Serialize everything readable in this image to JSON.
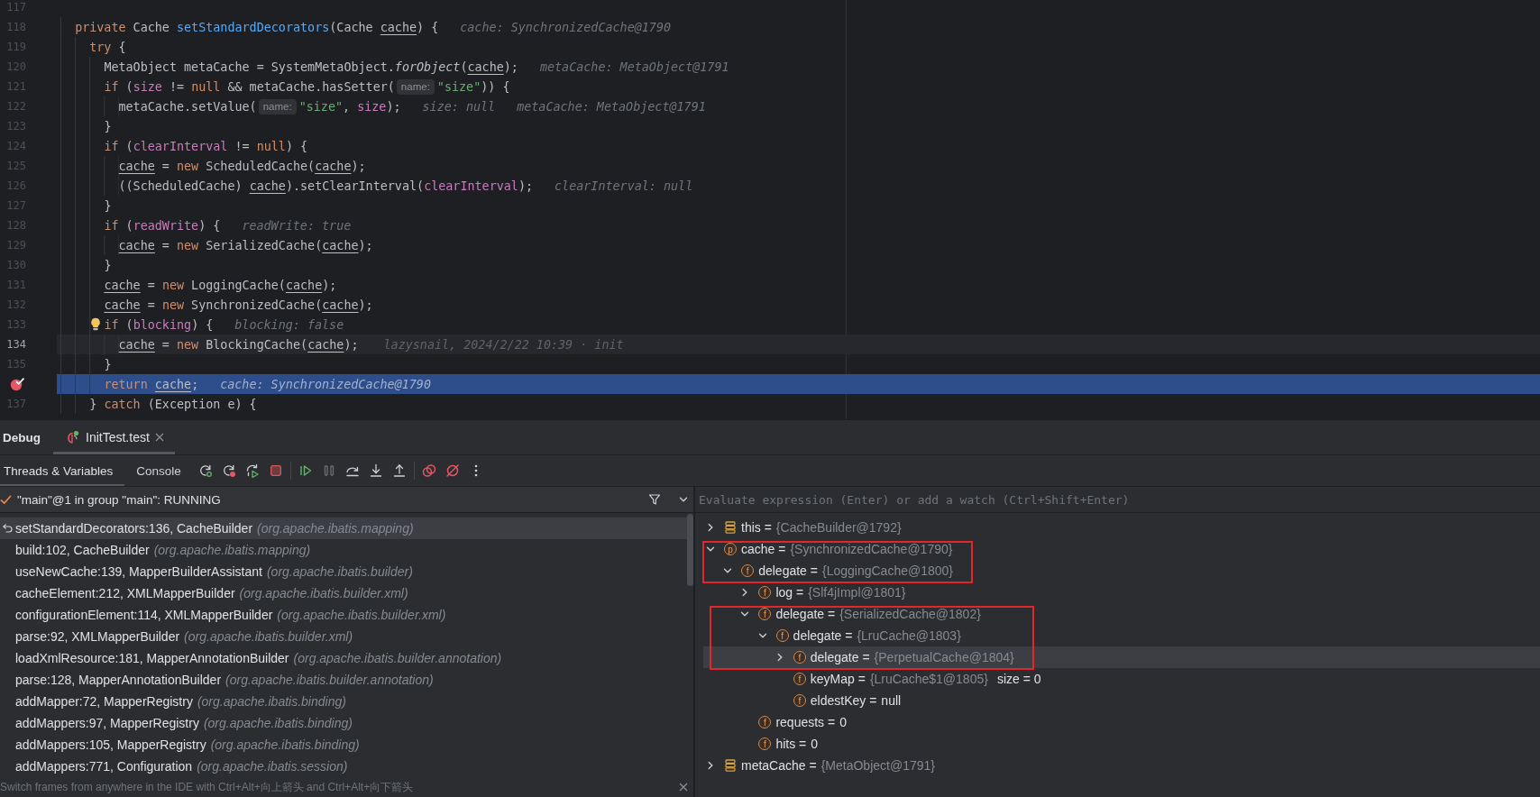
{
  "editor": {
    "lines": [
      {
        "number": "117",
        "current": false,
        "executing": false,
        "breakpoint": false,
        "bulb": false
      },
      {
        "number": "118",
        "current": false,
        "executing": false,
        "breakpoint": false,
        "bulb": false,
        "tokens": [
          {
            "kind": "keyword",
            "text": "  private"
          },
          {
            "kind": "plain",
            "text": " Cache "
          },
          {
            "kind": "method",
            "text": "setStandardDecorators"
          },
          {
            "kind": "plain",
            "text": "(Cache "
          },
          {
            "kind": "param",
            "text": "cache"
          },
          {
            "kind": "plain",
            "text": ") {"
          },
          {
            "kind": "value",
            "text": "cache: SynchronizedCache@1790"
          }
        ]
      },
      {
        "number": "119",
        "current": false,
        "executing": false,
        "breakpoint": false,
        "bulb": false,
        "tokens": [
          {
            "kind": "keyword",
            "text": "    try"
          },
          {
            "kind": "plain",
            "text": " {"
          }
        ]
      },
      {
        "number": "120",
        "current": false,
        "executing": false,
        "breakpoint": false,
        "bulb": false,
        "tokens": [
          {
            "kind": "plain",
            "text": "      MetaObject metaCache = SystemMetaObject."
          },
          {
            "kind": "static",
            "text": "forObject"
          },
          {
            "kind": "plain",
            "text": "("
          },
          {
            "kind": "param",
            "text": "cache"
          },
          {
            "kind": "plain",
            "text": ");"
          },
          {
            "kind": "value",
            "text": "metaCache: MetaObject@1791"
          }
        ]
      },
      {
        "number": "121",
        "current": false,
        "executing": false,
        "breakpoint": false,
        "bulb": false,
        "tokens": [
          {
            "kind": "keyword",
            "text": "      if"
          },
          {
            "kind": "plain",
            "text": " ("
          },
          {
            "kind": "field",
            "text": "size"
          },
          {
            "kind": "plain",
            "text": " != "
          },
          {
            "kind": "keyword",
            "text": "null"
          },
          {
            "kind": "plain",
            "text": " && metaCache.hasSetter("
          },
          {
            "kind": "hint",
            "text": "name:"
          },
          {
            "kind": "string",
            "text": "\"size\""
          },
          {
            "kind": "plain",
            "text": ")) {"
          }
        ]
      },
      {
        "number": "122",
        "current": false,
        "executing": false,
        "breakpoint": false,
        "bulb": false,
        "tokens": [
          {
            "kind": "plain",
            "text": "        metaCache.setValue("
          },
          {
            "kind": "hint",
            "text": "name:"
          },
          {
            "kind": "string",
            "text": "\"size\""
          },
          {
            "kind": "plain",
            "text": ", "
          },
          {
            "kind": "field",
            "text": "size"
          },
          {
            "kind": "plain",
            "text": ");"
          },
          {
            "kind": "value",
            "text": "size: null"
          },
          {
            "kind": "value",
            "text": "metaCache: MetaObject@1791"
          }
        ]
      },
      {
        "number": "123",
        "current": false,
        "executing": false,
        "breakpoint": false,
        "bulb": false,
        "tokens": [
          {
            "kind": "plain",
            "text": "      }"
          }
        ]
      },
      {
        "number": "124",
        "current": false,
        "executing": false,
        "breakpoint": false,
        "bulb": false,
        "tokens": [
          {
            "kind": "keyword",
            "text": "      if"
          },
          {
            "kind": "plain",
            "text": " ("
          },
          {
            "kind": "field",
            "text": "clearInterval"
          },
          {
            "kind": "plain",
            "text": " != "
          },
          {
            "kind": "keyword",
            "text": "null"
          },
          {
            "kind": "plain",
            "text": ") {"
          }
        ]
      },
      {
        "number": "125",
        "current": false,
        "executing": false,
        "breakpoint": false,
        "bulb": false,
        "tokens": [
          {
            "kind": "param",
            "text": "        cache"
          },
          {
            "kind": "plain",
            "text": " = "
          },
          {
            "kind": "keyword",
            "text": "new"
          },
          {
            "kind": "plain",
            "text": " ScheduledCache("
          },
          {
            "kind": "param",
            "text": "cache"
          },
          {
            "kind": "plain",
            "text": ");"
          }
        ]
      },
      {
        "number": "126",
        "current": false,
        "executing": false,
        "breakpoint": false,
        "bulb": false,
        "tokens": [
          {
            "kind": "plain",
            "text": "        ((ScheduledCache) "
          },
          {
            "kind": "param",
            "text": "cache"
          },
          {
            "kind": "plain",
            "text": ").setClearInterval("
          },
          {
            "kind": "field",
            "text": "clearInterval"
          },
          {
            "kind": "plain",
            "text": ");"
          },
          {
            "kind": "value",
            "text": "clearInterval: null"
          }
        ]
      },
      {
        "number": "127",
        "current": false,
        "executing": false,
        "breakpoint": false,
        "bulb": false,
        "tokens": [
          {
            "kind": "plain",
            "text": "      }"
          }
        ]
      },
      {
        "number": "128",
        "current": false,
        "executing": false,
        "breakpoint": false,
        "bulb": false,
        "tokens": [
          {
            "kind": "keyword",
            "text": "      if"
          },
          {
            "kind": "plain",
            "text": " ("
          },
          {
            "kind": "field",
            "text": "readWrite"
          },
          {
            "kind": "plain",
            "text": ") {"
          },
          {
            "kind": "value",
            "text": "readWrite: true"
          }
        ]
      },
      {
        "number": "129",
        "current": false,
        "executing": false,
        "breakpoint": false,
        "bulb": false,
        "tokens": [
          {
            "kind": "param",
            "text": "        cache"
          },
          {
            "kind": "plain",
            "text": " = "
          },
          {
            "kind": "keyword",
            "text": "new"
          },
          {
            "kind": "plain",
            "text": " SerializedCache("
          },
          {
            "kind": "param",
            "text": "cache"
          },
          {
            "kind": "plain",
            "text": ");"
          }
        ]
      },
      {
        "number": "130",
        "current": false,
        "executing": false,
        "breakpoint": false,
        "bulb": false,
        "tokens": [
          {
            "kind": "plain",
            "text": "      }"
          }
        ]
      },
      {
        "number": "131",
        "current": false,
        "executing": false,
        "breakpoint": false,
        "bulb": false,
        "tokens": [
          {
            "kind": "param",
            "text": "      cache"
          },
          {
            "kind": "plain",
            "text": " = "
          },
          {
            "kind": "keyword",
            "text": "new"
          },
          {
            "kind": "plain",
            "text": " LoggingCache("
          },
          {
            "kind": "param",
            "text": "cache"
          },
          {
            "kind": "plain",
            "text": ");"
          }
        ]
      },
      {
        "number": "132",
        "current": false,
        "executing": false,
        "breakpoint": false,
        "bulb": false,
        "tokens": [
          {
            "kind": "param",
            "text": "      cache"
          },
          {
            "kind": "plain",
            "text": " = "
          },
          {
            "kind": "keyword",
            "text": "new"
          },
          {
            "kind": "plain",
            "text": " SynchronizedCache("
          },
          {
            "kind": "param",
            "text": "cache"
          },
          {
            "kind": "plain",
            "text": ");"
          }
        ]
      },
      {
        "number": "133",
        "current": false,
        "executing": false,
        "breakpoint": false,
        "bulb": true,
        "tokens": [
          {
            "kind": "keyword",
            "text": "      if"
          },
          {
            "kind": "plain",
            "text": " ("
          },
          {
            "kind": "field",
            "text": "blocking"
          },
          {
            "kind": "plain",
            "text": ") {"
          },
          {
            "kind": "value",
            "text": "blocking: false"
          }
        ]
      },
      {
        "number": "134",
        "current": true,
        "executing": false,
        "breakpoint": false,
        "bulb": false,
        "tokens": [
          {
            "kind": "param",
            "text": "        cache"
          },
          {
            "kind": "plain",
            "text": " = "
          },
          {
            "kind": "keyword",
            "text": "new"
          },
          {
            "kind": "plain",
            "text": " BlockingCache("
          },
          {
            "kind": "param",
            "text": "cache"
          },
          {
            "kind": "plain",
            "text": ");"
          },
          {
            "kind": "blame",
            "text": "lazysnail, 2024/2/22 10:39 · init"
          }
        ]
      },
      {
        "number": "135",
        "current": false,
        "executing": false,
        "breakpoint": false,
        "bulb": false,
        "tokens": [
          {
            "kind": "plain",
            "text": "      }"
          }
        ]
      },
      {
        "current": false,
        "executing": true,
        "breakpoint": true,
        "bulb": false,
        "tokens": [
          {
            "kind": "keyword",
            "text": "      return "
          },
          {
            "kind": "param",
            "text": "cache"
          },
          {
            "kind": "plain",
            "text": ";"
          },
          {
            "kind": "value",
            "text": "cache: SynchronizedCache@1790"
          }
        ]
      },
      {
        "number": "137",
        "current": false,
        "executing": false,
        "breakpoint": false,
        "bulb": false,
        "tokens": [
          {
            "kind": "plain",
            "text": "    } "
          },
          {
            "kind": "keyword",
            "text": "catch"
          },
          {
            "kind": "plain",
            "text": " (Exception e) {"
          }
        ]
      }
    ]
  },
  "debug": {
    "title": "Debug",
    "sessions": [
      {
        "label": "InitTest.test",
        "selected": true
      }
    ],
    "view_tabs": [
      {
        "label": "Threads & Variables",
        "selected": true
      },
      {
        "label": "Console",
        "selected": false
      }
    ],
    "action_groups": [
      {
        "actions": [
          {
            "kind": "rerun",
            "disabled": false
          },
          {
            "kind": "rerun_failed",
            "disabled": false
          },
          {
            "kind": "reload",
            "disabled": false
          },
          {
            "kind": "stop",
            "disabled": false
          }
        ]
      },
      {
        "actions": [
          {
            "kind": "resume",
            "disabled": false
          },
          {
            "kind": "pause",
            "disabled": true
          },
          {
            "kind": "step_over",
            "disabled": false
          },
          {
            "kind": "step_into",
            "disabled": false
          },
          {
            "kind": "step_out",
            "disabled": false
          }
        ]
      },
      {
        "actions": [
          {
            "kind": "breakpoints",
            "disabled": false
          },
          {
            "kind": "mute_breakpoints",
            "disabled": false
          },
          {
            "kind": "more",
            "disabled": false
          }
        ]
      }
    ],
    "thread": {
      "label": "\"main\"@1 in group \"main\": RUNNING"
    },
    "frames": [
      {
        "kind": "current",
        "method": "setStandardDecorators:136, CacheBuilder",
        "package": "(org.apache.ibatis.mapping)",
        "selected": true
      },
      {
        "kind": "caller",
        "method": "build:102, CacheBuilder",
        "package": "(org.apache.ibatis.mapping)",
        "selected": false
      },
      {
        "kind": "caller",
        "method": "useNewCache:139, MapperBuilderAssistant",
        "package": "(org.apache.ibatis.builder)",
        "selected": false
      },
      {
        "kind": "caller",
        "method": "cacheElement:212, XMLMapperBuilder",
        "package": "(org.apache.ibatis.builder.xml)",
        "selected": false
      },
      {
        "kind": "caller",
        "method": "configurationElement:114, XMLMapperBuilder",
        "package": "(org.apache.ibatis.builder.xml)",
        "selected": false
      },
      {
        "kind": "caller",
        "method": "parse:92, XMLMapperBuilder",
        "package": "(org.apache.ibatis.builder.xml)",
        "selected": false
      },
      {
        "kind": "caller",
        "method": "loadXmlResource:181, MapperAnnotationBuilder",
        "package": "(org.apache.ibatis.builder.annotation)",
        "selected": false
      },
      {
        "kind": "caller",
        "method": "parse:128, MapperAnnotationBuilder",
        "package": "(org.apache.ibatis.builder.annotation)",
        "selected": false
      },
      {
        "kind": "caller",
        "method": "addMapper:72, MapperRegistry",
        "package": "(org.apache.ibatis.binding)",
        "selected": false
      },
      {
        "kind": "caller",
        "method": "addMappers:97, MapperRegistry",
        "package": "(org.apache.ibatis.binding)",
        "selected": false
      },
      {
        "kind": "caller",
        "method": "addMappers:105, MapperRegistry",
        "package": "(org.apache.ibatis.binding)",
        "selected": false
      },
      {
        "kind": "caller",
        "method": "addMappers:771, Configuration",
        "package": "(org.apache.ibatis.session)",
        "selected": false
      }
    ],
    "hint": "Switch frames from anywhere in the IDE with Ctrl+Alt+向上箭头 and Ctrl+Alt+向下箭头",
    "variables": {
      "placeholder": "Evaluate expression (Enter) or add a watch (Ctrl+Shift+Enter)",
      "items": [
        {
          "kind": "object",
          "label": "this =",
          "value": "{CacheBuilder@1792}",
          "value_dimmed": true,
          "expandable": true,
          "expanded": false,
          "selected": false,
          "outlined": false
        },
        {
          "kind": "parameter",
          "badge": "p",
          "label": "cache =",
          "value": "{SynchronizedCache@1790}",
          "value_dimmed": true,
          "expandable": true,
          "expanded": true,
          "selected": false,
          "outlined": true,
          "children": [
            {
              "kind": "field",
              "badge": "f",
              "label": "delegate =",
              "value": "{LoggingCache@1800}",
              "value_dimmed": true,
              "expandable": true,
              "expanded": true,
              "selected": false,
              "outlined": true,
              "children": [
                {
                  "kind": "field",
                  "badge": "f",
                  "label": "log =",
                  "value": "{Slf4jImpl@1801}",
                  "value_dimmed": true,
                  "expandable": true,
                  "expanded": false,
                  "selected": false,
                  "outlined": false
                },
                {
                  "kind": "field",
                  "badge": "f",
                  "label": "delegate =",
                  "value": "{SerializedCache@1802}",
                  "value_dimmed": true,
                  "expandable": true,
                  "expanded": true,
                  "selected": false,
                  "outlined": true,
                  "children": [
                    {
                      "kind": "field",
                      "badge": "f",
                      "label": "delegate =",
                      "value": "{LruCache@1803}",
                      "value_dimmed": true,
                      "expandable": true,
                      "expanded": true,
                      "selected": false,
                      "outlined": true,
                      "children": [
                        {
                          "kind": "field",
                          "badge": "f",
                          "label": "delegate =",
                          "value": "{PerpetualCache@1804}",
                          "value_dimmed": true,
                          "expandable": true,
                          "expanded": false,
                          "selected": true,
                          "outlined": true
                        },
                        {
                          "kind": "field",
                          "badge": "f",
                          "label": "keyMap =",
                          "value": "{LruCache$1@1805}",
                          "value_dimmed": true,
                          "extra": "size = 0",
                          "expandable": false,
                          "selected": false,
                          "outlined": false
                        },
                        {
                          "kind": "field",
                          "badge": "f",
                          "label": "eldestKey =",
                          "value": "null",
                          "value_dimmed": false,
                          "expandable": false,
                          "selected": false,
                          "outlined": false
                        }
                      ]
                    }
                  ]
                },
                {
                  "kind": "field",
                  "badge": "f",
                  "label": "requests =",
                  "value": "0",
                  "value_dimmed": false,
                  "expandable": false,
                  "selected": false,
                  "outlined": false
                },
                {
                  "kind": "field",
                  "badge": "f",
                  "label": "hits =",
                  "value": "0",
                  "value_dimmed": false,
                  "expandable": false,
                  "selected": false,
                  "outlined": false
                }
              ]
            }
          ]
        },
        {
          "kind": "object",
          "label": "metaCache =",
          "value": "{MetaObject@1791}",
          "value_dimmed": true,
          "expandable": true,
          "expanded": false,
          "selected": false,
          "outlined": false
        }
      ]
    }
  }
}
